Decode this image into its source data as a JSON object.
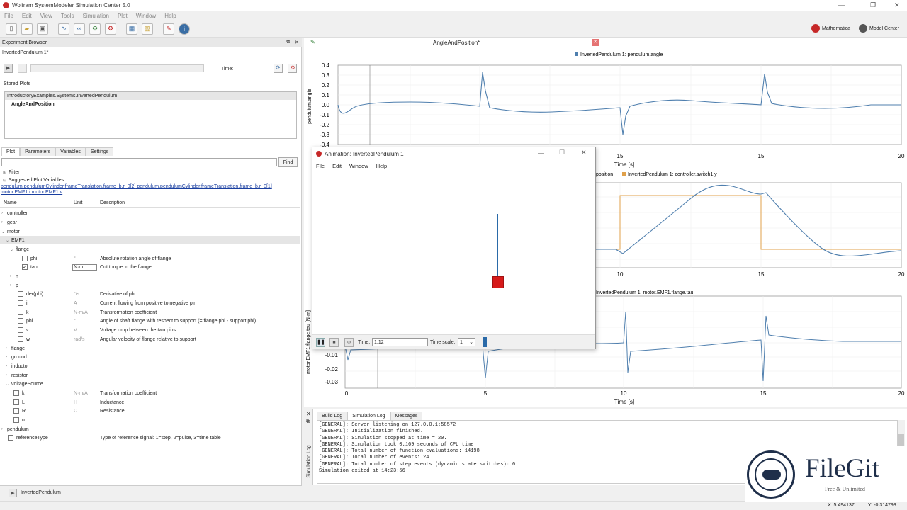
{
  "app": {
    "title": "Wolfram SystemModeler Simulation Center 5.0",
    "menu": [
      "File",
      "Edit",
      "View",
      "Tools",
      "Simulation",
      "Plot",
      "Window",
      "Help"
    ],
    "mathematica_label": "Mathematica",
    "model_center_label": "Model Center"
  },
  "experiment": {
    "header": "Experiment Browser",
    "name": "InvertedPendulum 1*",
    "time_label": "Time:",
    "stored_plots_label": "Stored Plots",
    "stored_path": "IntroductoryExamples.Systems.InvertedPendulum",
    "stored_plot": "AngleAndPosition"
  },
  "plot_tabs": [
    "Plot",
    "Parameters",
    "Variables",
    "Settings"
  ],
  "search": {
    "find_label": "Find",
    "value": ""
  },
  "filter_label": "Filter",
  "suggested": {
    "label": "Suggested Plot Variables",
    "line1a": "pendulum.pendulumCylinder.frameTranslation.frame_b.r_0[2]",
    "line1b": "pendulum.pendulumCylinder.frameTranslation.frame_b.r_0[1]",
    "line2a": "motor.EMF1.i",
    "line2b": "motor.EMF1.v"
  },
  "columns": {
    "name": "Name",
    "unit": "Unit",
    "description": "Description"
  },
  "tree": [
    {
      "label": "controller",
      "unit": "",
      "desc": ""
    },
    {
      "label": "gear",
      "unit": "",
      "desc": ""
    },
    {
      "label": "motor",
      "unit": "",
      "desc": ""
    },
    {
      "label": "EMF1",
      "unit": "",
      "desc": ""
    },
    {
      "label": "flange",
      "unit": "",
      "desc": ""
    },
    {
      "label": "phi",
      "unit": "°",
      "desc": "Absolute rotation angle of flange"
    },
    {
      "label": "tau",
      "unit": "N·m",
      "desc": "Cut torque in the flange"
    },
    {
      "label": "n",
      "unit": "",
      "desc": ""
    },
    {
      "label": "p",
      "unit": "",
      "desc": ""
    },
    {
      "label": "der(phi)",
      "unit": "°/s",
      "desc": "Derivative of phi"
    },
    {
      "label": "i",
      "unit": "A",
      "desc": "Current flowing from positive to negative pin"
    },
    {
      "label": "k",
      "unit": "N·m/A",
      "desc": "Transformation coefficient"
    },
    {
      "label": "phi",
      "unit": "°",
      "desc": "Angle of shaft flange with respect to support (= flange.phi - support.phi)"
    },
    {
      "label": "v",
      "unit": "V",
      "desc": "Voltage drop between the two pins"
    },
    {
      "label": "w",
      "unit": "rad/s",
      "desc": "Angular velocity of flange relative to support"
    },
    {
      "label": "flange",
      "unit": "",
      "desc": ""
    },
    {
      "label": "ground",
      "unit": "",
      "desc": ""
    },
    {
      "label": "inductor",
      "unit": "",
      "desc": ""
    },
    {
      "label": "resistor",
      "unit": "",
      "desc": ""
    },
    {
      "label": "voltageSource",
      "unit": "",
      "desc": ""
    },
    {
      "label": "k",
      "unit": "N·m/A",
      "desc": "Transformation coefficient"
    },
    {
      "label": "L",
      "unit": "H",
      "desc": "Inductance"
    },
    {
      "label": "R",
      "unit": "Ω",
      "desc": "Resistance"
    },
    {
      "label": "u",
      "unit": "",
      "desc": ""
    },
    {
      "label": "pendulum",
      "unit": "",
      "desc": ""
    },
    {
      "label": "referenceType",
      "unit": "",
      "desc": "Type of reference signal: 1=step, 2=pulse, 3=time table"
    }
  ],
  "bottom_item": "InvertedPendulum",
  "plot": {
    "title": "AngleAndPosition*",
    "chart1": {
      "legend": "InvertedPendulum 1: pendulum.angle",
      "ylabel": "pendulum.angle",
      "xlabel": "Time [s]",
      "yticks": [
        "0.4",
        "0.3",
        "0.2",
        "0.1",
        "0.0",
        "-0.1",
        "-0.2",
        "-0.3",
        "-0.4"
      ],
      "xticks": [
        "0",
        "5",
        "10",
        "15",
        "20"
      ]
    },
    "chart2": {
      "legend1": "position",
      "legend2": "InvertedPendulum 1: controller.switch1.y",
      "xlabel": "Time [s]",
      "xticks": [
        "10",
        "15",
        "20"
      ]
    },
    "chart3": {
      "legend": "InvertedPendulum 1: motor.EMF1.flange.tau",
      "ylabel": "motor.EMF1.flange.tau [N·m]",
      "xlabel": "Time [s]",
      "yticks": [
        "-0.01",
        "-0.02",
        "-0.03"
      ],
      "xticks": [
        "0",
        "5",
        "10",
        "15",
        "20"
      ]
    },
    "colors": {
      "series_blue": "#4f7fae",
      "series_orange": "#e0a14b",
      "series_red": "#c0504d"
    }
  },
  "animation": {
    "title": "Animation: InvertedPendulum 1",
    "menu": [
      "File",
      "Edit",
      "Window",
      "Help"
    ],
    "time_label": "Time:",
    "time_value": "1.12",
    "timescale_label": "Time scale:",
    "timescale_value": "1"
  },
  "log": {
    "tabs": [
      "Build Log",
      "Simulation Log",
      "Messages"
    ],
    "side_label": "Simulation Log",
    "lines": [
      "[GENERAL]: Server listening on 127.0.0.1:58572",
      "[GENERAL]: Initialization finished.",
      "[GENERAL]: Simulation stopped at time = 20.",
      "[GENERAL]: Simulation took 0.169 seconds of CPU time.",
      "[GENERAL]: Total number of function evaluations: 14198",
      "[GENERAL]: Total number of events: 24",
      "[GENERAL]: Total number of step events (dynamic state switches): 0",
      "Simulation exited at 14:23:56"
    ]
  },
  "status": {
    "x": "X: 5.494137",
    "y": "Y: -0.314793"
  },
  "watermark": {
    "name": "FileGit",
    "tagline": "Free & Unlimited"
  }
}
